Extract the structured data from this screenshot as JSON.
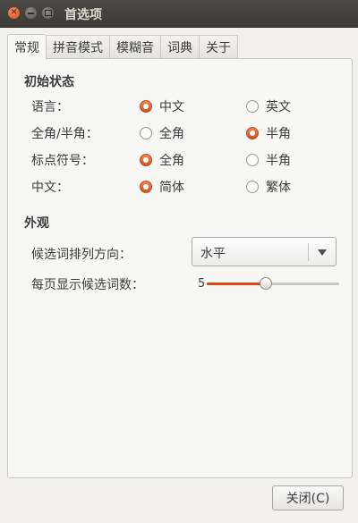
{
  "window": {
    "title": "首选项"
  },
  "tabs": [
    {
      "label": "常规",
      "active": true
    },
    {
      "label": "拼音模式",
      "active": false
    },
    {
      "label": "模糊音",
      "active": false
    },
    {
      "label": "词典",
      "active": false
    },
    {
      "label": "关于",
      "active": false
    }
  ],
  "initial_state": {
    "heading": "初始状态",
    "rows": [
      {
        "label": "语言：",
        "option_a": "中文",
        "option_b": "英文",
        "selected": "a"
      },
      {
        "label": "全角/半角：",
        "option_a": "全角",
        "option_b": "半角",
        "selected": "b"
      },
      {
        "label": "标点符号：",
        "option_a": "全角",
        "option_b": "半角",
        "selected": "a"
      },
      {
        "label": "中文：",
        "option_a": "简体",
        "option_b": "繁体",
        "selected": "a"
      }
    ]
  },
  "appearance": {
    "heading": "外观",
    "orientation_label": "候选词排列方向：",
    "orientation_value": "水平",
    "page_size_label": "每页显示候选词数：",
    "page_size_value": "5",
    "page_size_min": 1,
    "page_size_max": 10
  },
  "footer": {
    "close_label": "关闭(C)"
  },
  "colors": {
    "accent": "#dd4814",
    "titlebar": "#3c3b37",
    "background": "#f2f1f0"
  }
}
